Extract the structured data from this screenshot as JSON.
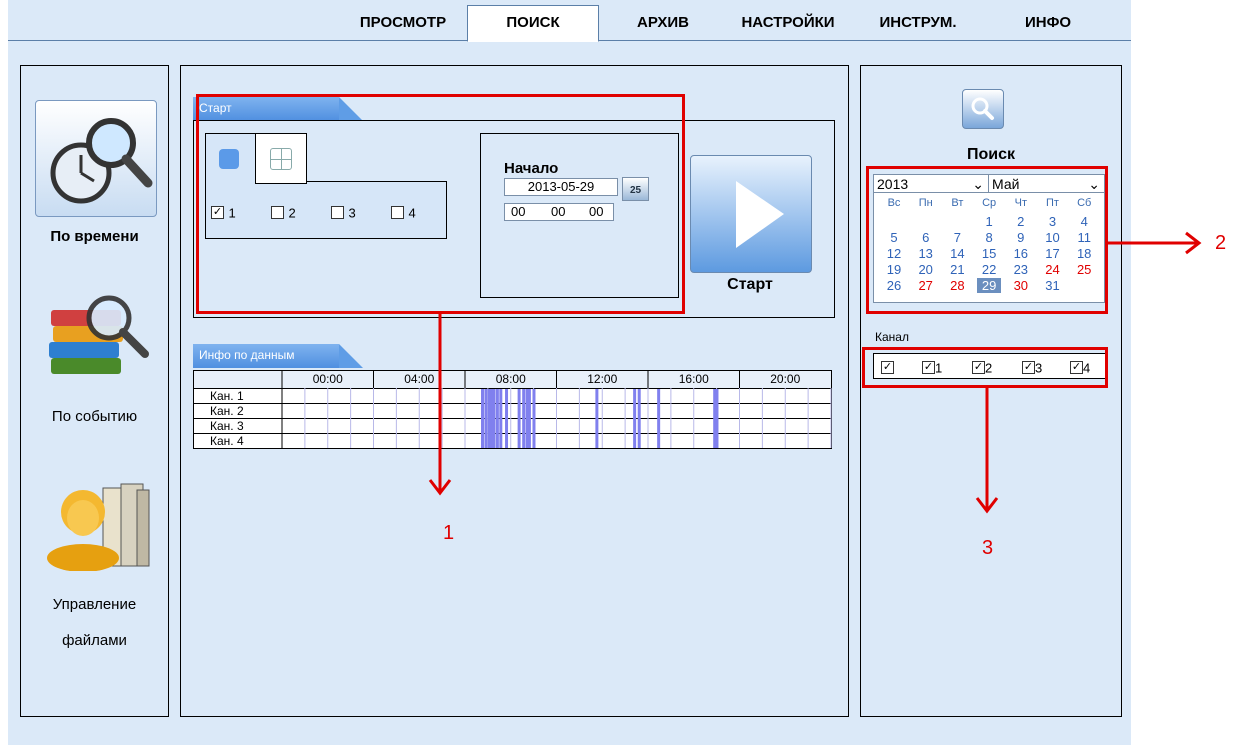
{
  "nav": {
    "tabs": [
      "ПРОСМОТР",
      "ПОИСК",
      "АРХИВ",
      "НАСТРОЙКИ",
      "ИНСТРУМ.",
      "ИНФО"
    ],
    "active": "ПОИСК"
  },
  "sidebar": {
    "items": [
      {
        "label": "По времени",
        "icon": "clock-magnifier-icon"
      },
      {
        "label": "По событию",
        "icon": "books-magnifier-icon"
      },
      {
        "label_line1": "Управление",
        "label_line2": "файлами",
        "icon": "user-files-icon"
      }
    ]
  },
  "start_section": {
    "tab_label": "Старт",
    "start_label": "Начало",
    "date": "2013-05-29",
    "calendar_day": "25",
    "hour": "00",
    "minute": "00",
    "second": "00",
    "channels": [
      "1",
      "2",
      "3",
      "4"
    ],
    "checked": [
      true,
      false,
      false,
      false
    ],
    "start_button_label": "Старт"
  },
  "data_info": {
    "tab_label": "Инфо по данным",
    "time_headers": [
      "00:00",
      "04:00",
      "08:00",
      "12:00",
      "16:00",
      "20:00"
    ],
    "rows": [
      "Кан. 1",
      "Кан. 2",
      "Кан. 3",
      "Кан. 4"
    ]
  },
  "right_panel": {
    "search_label": "Поиск",
    "year": "2013",
    "month": "Май",
    "weekdays": [
      "Вс",
      "Пн",
      "Вт",
      "Ср",
      "Чт",
      "Пт",
      "Сб"
    ],
    "weeks": [
      [
        "",
        "",
        "",
        "1",
        "2",
        "3",
        "4"
      ],
      [
        "5",
        "6",
        "7",
        "8",
        "9",
        "10",
        "11"
      ],
      [
        "12",
        "13",
        "14",
        "15",
        "16",
        "17",
        "18"
      ],
      [
        "19",
        "20",
        "21",
        "22",
        "23",
        "24",
        "25"
      ],
      [
        "26",
        "27",
        "28",
        "29",
        "30",
        "31",
        ""
      ]
    ],
    "red_days": [
      "24",
      "25",
      "27",
      "28",
      "30"
    ],
    "selected_day": "29",
    "channel_label": "Канал",
    "channels": [
      "1",
      "2",
      "3",
      "4"
    ]
  },
  "annotations": [
    "1",
    "2",
    "3"
  ],
  "colors": {
    "accent": "#4f8fe0",
    "highlight": "#e00000",
    "record": "#8080ee"
  }
}
